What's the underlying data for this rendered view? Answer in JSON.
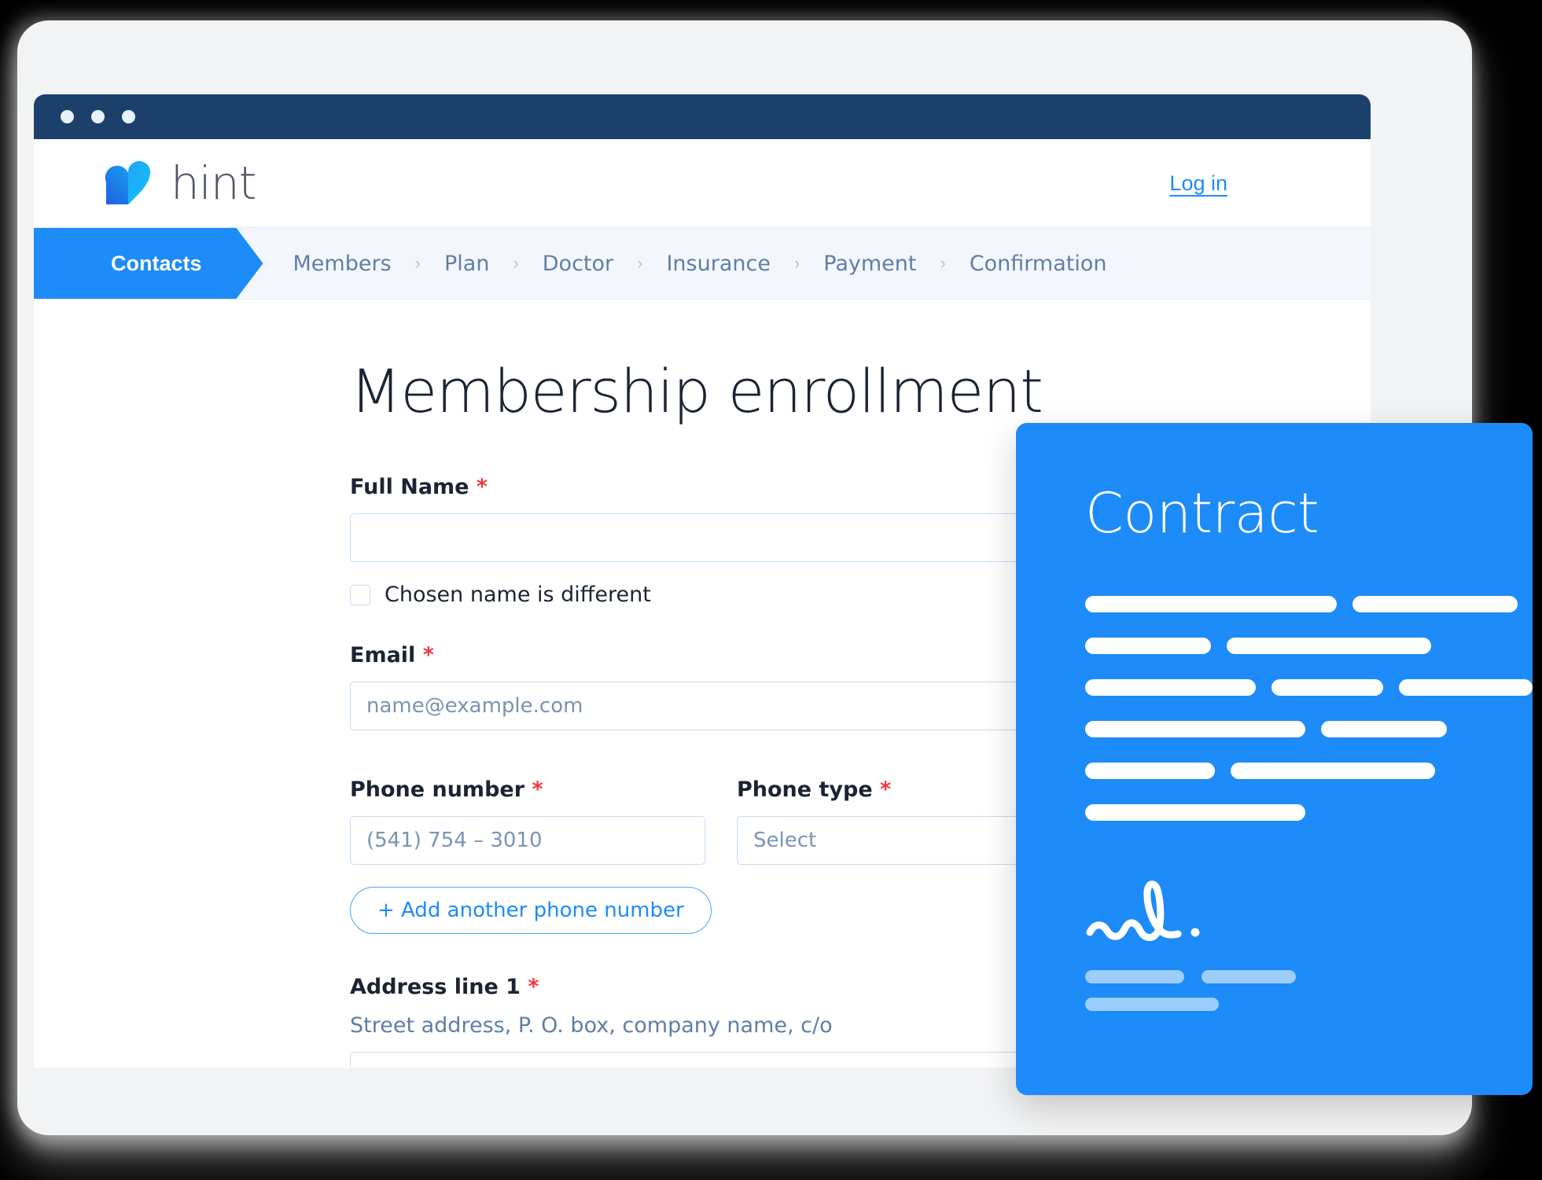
{
  "window": {
    "dots": [
      "close-dot",
      "minimize-dot",
      "maximize-dot"
    ]
  },
  "header": {
    "brand_name": "hint",
    "brand_icon": "heart-logo-icon",
    "login_label": "Log in"
  },
  "steps": {
    "active": "Contacts",
    "items": [
      "Members",
      "Plan",
      "Doctor",
      "Insurance",
      "Payment",
      "Confirmation"
    ],
    "separator": "›"
  },
  "form": {
    "title": "Membership enrollment",
    "required_marker": "*",
    "full_name": {
      "label": "Full Name",
      "value": "",
      "placeholder": ""
    },
    "chosen_name": {
      "label": "Chosen name is different",
      "checked": false
    },
    "email": {
      "label": "Email",
      "value": "",
      "placeholder": "name@example.com"
    },
    "phone_number": {
      "label": "Phone number",
      "value": "",
      "placeholder": "(541) 754 – 3010"
    },
    "phone_type": {
      "label": "Phone type",
      "value": "",
      "placeholder": "Select"
    },
    "add_phone_button": "+ Add another phone number",
    "address_line_1": {
      "label": "Address line 1",
      "hint": "Street address, P. O. box, company name, c/o",
      "value": "",
      "placeholder": ""
    }
  },
  "contract_card": {
    "title": "Contract",
    "signature_icon": "handwritten-signature-icon",
    "body_lines": [
      [
        320,
        210
      ],
      [
        160,
        260
      ],
      [
        230,
        150,
        180
      ],
      [
        280,
        160
      ],
      [
        165,
        260
      ],
      [
        280
      ]
    ],
    "signature_lines": [
      [
        126,
        120
      ],
      [
        170
      ]
    ]
  },
  "colors": {
    "accent_blue": "#1d8bf8",
    "titlebar_navy": "#1b406c",
    "required_red": "#f0363f",
    "step_bg": "#f3f7fd",
    "muted_text": "#5f7ea6",
    "input_border": "#c5ddf5",
    "dim_bar": "#9ccdfb"
  }
}
